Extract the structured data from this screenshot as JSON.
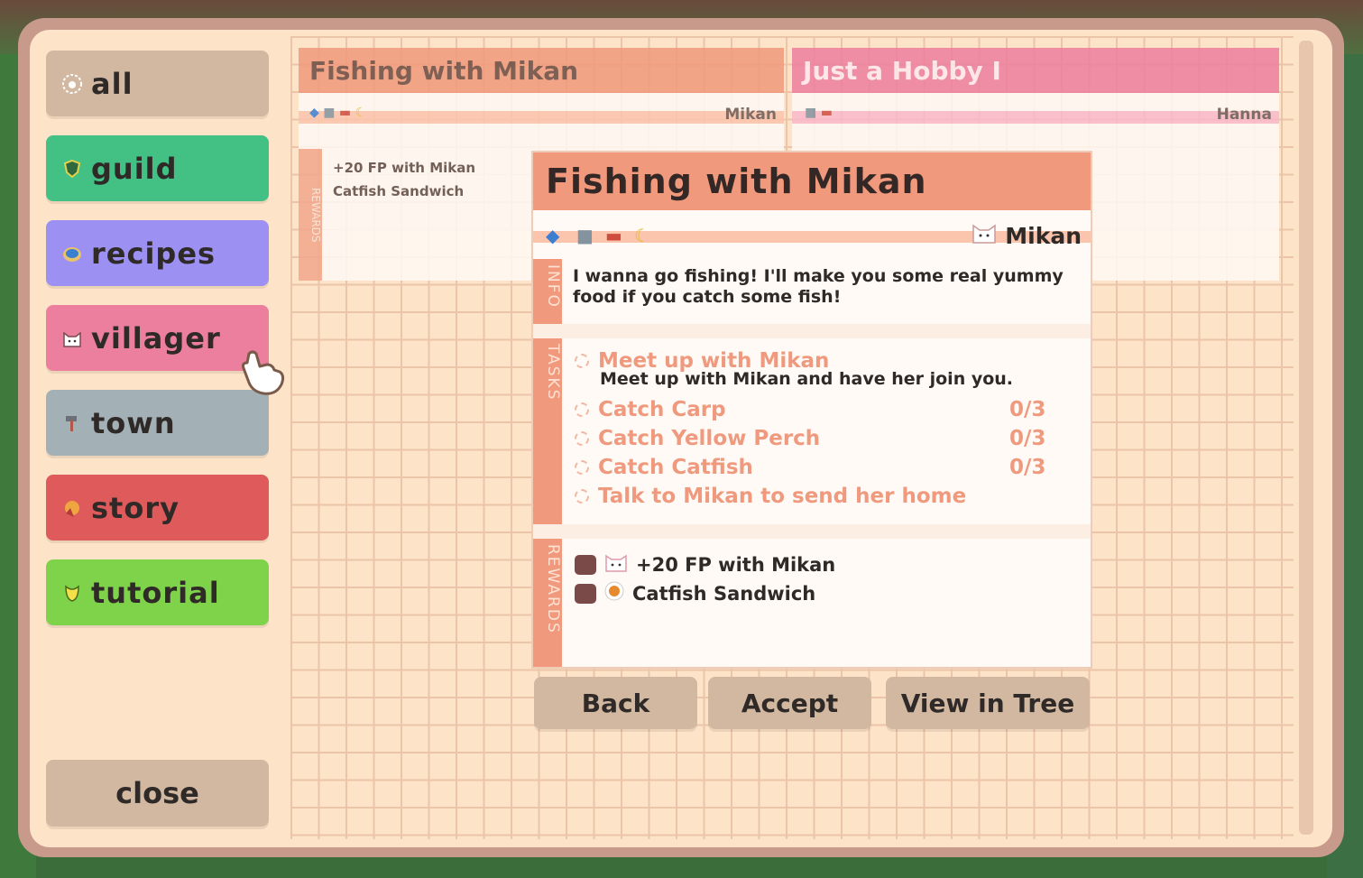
{
  "categories": [
    {
      "label": "all",
      "icon": "paw-icon",
      "color": "#d2b8a1"
    },
    {
      "label": "guild",
      "icon": "shield-icon",
      "color": "#43c083"
    },
    {
      "label": "recipes",
      "icon": "plate-icon",
      "color": "#9c90f3"
    },
    {
      "label": "villager",
      "icon": "cat-face-icon",
      "color": "#ec7f9d"
    },
    {
      "label": "town",
      "icon": "hammer-icon",
      "color": "#a3b0b6"
    },
    {
      "label": "story",
      "icon": "ribbon-icon",
      "color": "#df5b5b"
    },
    {
      "label": "tutorial",
      "icon": "leaf-icon",
      "color": "#7fd34a"
    }
  ],
  "close_label": "close",
  "background_cards": [
    {
      "title": "Fishing with Mikan",
      "npc": "Mikan",
      "head_color": "#f1997c",
      "strip_color": "#fbc5ad",
      "side_label": "REWARDS",
      "rewards": [
        "+20 FP with Mikan",
        "Catfish Sandwich"
      ]
    },
    {
      "title": "Just a Hobby I",
      "npc": "Hanna",
      "head_color": "#ec7f9d",
      "strip_color": "#f9b9cb"
    }
  ],
  "modal": {
    "title": "Fishing with Mikan",
    "npc": "Mikan",
    "info_label": "INFO",
    "info_text": "I wanna go fishing! I'll make you some real yummy food if you catch some fish!",
    "tasks_label": "TASKS",
    "tasks": [
      {
        "name": "Meet up with Mikan",
        "desc": "Meet up with Mikan and have her join you.",
        "count": ""
      },
      {
        "name": "Catch Carp",
        "desc": "",
        "count": "0/3"
      },
      {
        "name": "Catch Yellow Perch",
        "desc": "",
        "count": "0/3"
      },
      {
        "name": "Catch Catfish",
        "desc": "",
        "count": "0/3"
      },
      {
        "name": "Talk to Mikan to send her home",
        "desc": "",
        "count": ""
      }
    ],
    "rewards_label": "REWARDS",
    "rewards": [
      {
        "text": "+20 FP with Mikan",
        "icon": "cat-face-icon"
      },
      {
        "text": "Catfish Sandwich",
        "icon": "sandwich-icon"
      }
    ]
  },
  "buttons": {
    "back": "Back",
    "accept": "Accept",
    "view_tree": "View in Tree"
  }
}
